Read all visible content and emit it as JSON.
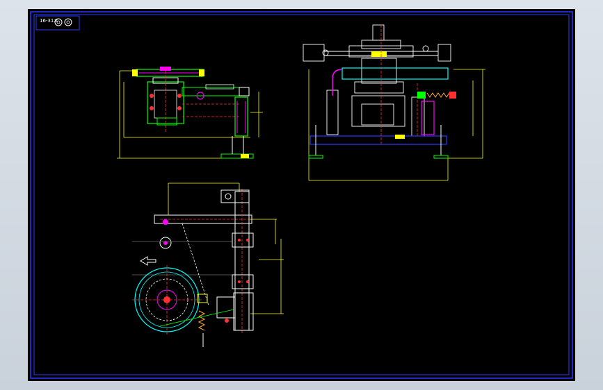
{
  "drawing": {
    "title_block": {
      "label": "16-31#",
      "icon_names": [
        "bearing-symbol-icon",
        "bearing-symbol-icon"
      ]
    },
    "views": [
      {
        "name": "side-view"
      },
      {
        "name": "front-view"
      },
      {
        "name": "plan-view"
      }
    ],
    "colors": {
      "background": "#000000",
      "border": "#2c39ff",
      "dimension": "#ffff00",
      "outline": "#ffffff",
      "centerline": "#ff3030",
      "part_green": "#00ff00",
      "part_cyan": "#00ffff",
      "part_magenta": "#ff00ff"
    }
  }
}
